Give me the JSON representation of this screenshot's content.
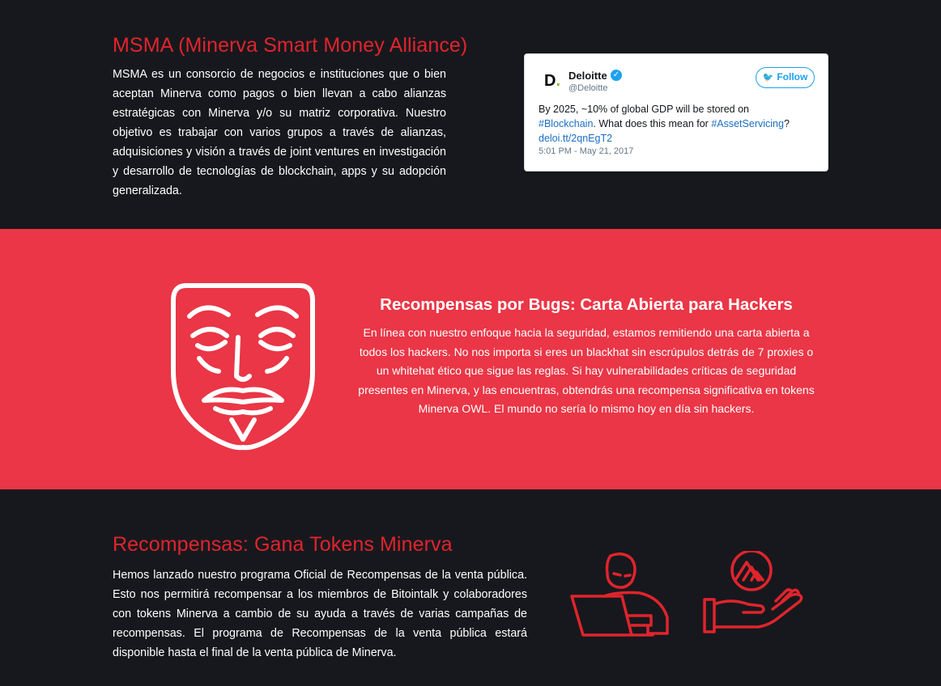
{
  "msma": {
    "title": "MSMA (Minerva Smart Money Alliance)",
    "text": "MSMA es un consorcio de negocios e instituciones que o bien aceptan Minerva como pagos o bien llevan a cabo alianzas estratégicas con Minerva y/o su matriz corporativa. Nuestro objetivo es trabajar con varios grupos a través de alianzas, adquisiciones y visión a través de joint ventures en investigación y desarrollo de tecnologías de blockchain, apps y su adopción generalizada."
  },
  "tweet": {
    "logo": "D",
    "logo_dot": ".",
    "name": "Deloitte",
    "handle": "@Deloitte",
    "follow_label": "Follow",
    "text_1": "By 2025, ~10% of global GDP will be stored on",
    "hashtag_1": "#Blockchain",
    "text_2": ". What does this mean for ",
    "hashtag_2": "#AssetServicing",
    "text_3": "?",
    "link": "deloi.tt/2qnEgT2",
    "date": "5:01 PM - May 21, 2017",
    "link_color": "#1b6ec2",
    "verified_icon": "check",
    "follow_icon": "twitter-bird"
  },
  "bugs": {
    "title": "Recompensas por Bugs: Carta Abierta para Hackers",
    "text": "En línea con nuestro enfoque hacia la seguridad, estamos remitiendo una carta abierta a todos los hackers. No nos importa si eres un blackhat sin escrúpulos detrás de 7 proxies o un whitehat ético que sigue las reglas. Si hay vulnerabilidades críticas de seguridad presentes en Minerva, y las encuentras, obtendrás una recompensa significativa en tokens Minerva OWL. El mundo no sería lo mismo hoy en día sin hackers.",
    "icon": "guy-fawkes-mask-icon"
  },
  "rewards": {
    "title": "Recompensas: Gana Tokens Minerva",
    "text": "Hemos lanzado nuestro programa Oficial de Recompensas de la venta pública. Esto nos permitirá recompensar a los miembros de Bitointalk y colaboradores con tokens Minerva a cambio de su ayuda a través de varias campañas de recompensas. El programa de Recompensas de la venta pública estará disponible hasta el final de la venta pública de Minerva.",
    "icons": [
      "person-laptop-icon",
      "hand-token-icon"
    ]
  },
  "colors": {
    "dark_bg": "#17181d",
    "red_band": "#ea3646",
    "heading_red": "#e0242d",
    "twitter_blue": "#1da1f2"
  }
}
